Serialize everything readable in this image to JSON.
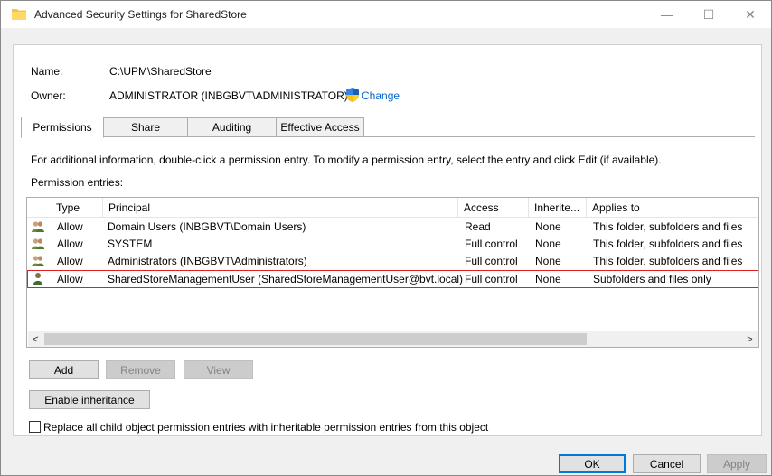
{
  "window": {
    "title": "Advanced Security Settings for SharedStore",
    "minimize_glyph": "—",
    "maximize_glyph": "☐",
    "close_glyph": "✕"
  },
  "info": {
    "name_label": "Name:",
    "name_value": "C:\\UPM\\SharedStore",
    "owner_label": "Owner:",
    "owner_value": "ADMINISTRATOR (INBGBVT\\ADMINISTRATOR)",
    "change_link": "Change"
  },
  "tabs": [
    {
      "label": "Permissions",
      "active": true
    },
    {
      "label": "Share",
      "active": false
    },
    {
      "label": "Auditing",
      "active": false
    },
    {
      "label": "Effective Access",
      "active": false
    }
  ],
  "instructions": "For additional information, double-click a permission entry. To modify a permission entry, select the entry and click Edit (if available).",
  "entries_label": "Permission entries:",
  "table": {
    "columns": [
      "Type",
      "Principal",
      "Access",
      "Inherite...",
      "Applies to"
    ],
    "rows": [
      {
        "icon": "group-users-icon",
        "type": "Allow",
        "principal": "Domain Users (INBGBVT\\Domain Users)",
        "access": "Read",
        "inherited": "None",
        "applies": "This folder, subfolders and files"
      },
      {
        "icon": "group-users-icon",
        "type": "Allow",
        "principal": "SYSTEM",
        "access": "Full control",
        "inherited": "None",
        "applies": "This folder, subfolders and files"
      },
      {
        "icon": "group-users-icon",
        "type": "Allow",
        "principal": "Administrators (INBGBVT\\Administrators)",
        "access": "Full control",
        "inherited": "None",
        "applies": "This folder, subfolders and files"
      },
      {
        "icon": "single-user-icon",
        "type": "Allow",
        "principal": "SharedStoreManagementUser (SharedStoreManagementUser@bvt.local)",
        "access": "Full control",
        "inherited": "None",
        "applies": "Subfolders and files only"
      }
    ]
  },
  "scroll": {
    "left": "<",
    "right": ">"
  },
  "buttons": {
    "add": "Add",
    "remove": "Remove",
    "view": "View",
    "enable_inheritance": "Enable inheritance",
    "ok": "OK",
    "cancel": "Cancel",
    "apply": "Apply"
  },
  "replace_checkbox_label": "Replace all child object permission entries with inheritable permission entries from this object",
  "colors": {
    "highlight_outline": "#e02020",
    "link": "#0066cc"
  }
}
